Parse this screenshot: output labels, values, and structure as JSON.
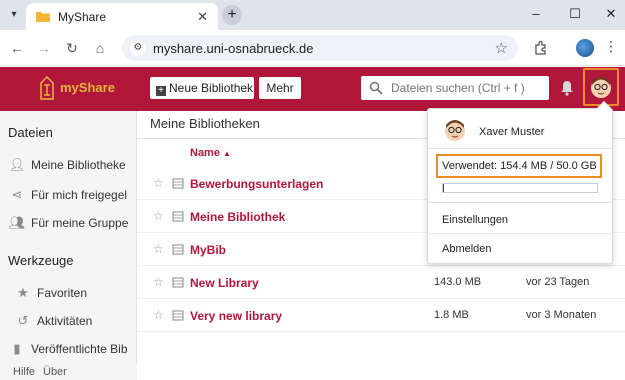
{
  "browser": {
    "tab_title": "MyShare",
    "url": "myshare.uni-osnabrueck.de"
  },
  "header": {
    "logo_text": "myShare",
    "new_library_label": "Neue Bibliothek",
    "more_label": "Mehr",
    "search_placeholder": "Dateien suchen (Ctrl + f )"
  },
  "sidebar": {
    "files_heading": "Dateien",
    "file_items": [
      {
        "label": "Meine Bibliotheke",
        "icon": "person-icon"
      },
      {
        "label": "Für mich freigegel",
        "icon": "share-icon"
      },
      {
        "label": "Für meine Gruppe",
        "icon": "group-icon"
      }
    ],
    "tools_heading": "Werkzeuge",
    "tool_items": [
      {
        "label": "Favoriten",
        "icon": "star-icon"
      },
      {
        "label": "Aktivitäten",
        "icon": "history-icon"
      },
      {
        "label": "Veröffentlichte Bib",
        "icon": "book-icon"
      }
    ],
    "footer": {
      "help": "Hilfe",
      "about": "Über"
    }
  },
  "main": {
    "title": "Meine Bibliotheken",
    "col_name": "Name",
    "sort_indicator": "▲",
    "rows": [
      {
        "name": "Bewerbungsunterlagen",
        "size": "",
        "modified": ""
      },
      {
        "name": "Meine Bibliothek",
        "size": "",
        "modified": ""
      },
      {
        "name": "MyBib",
        "size": "",
        "modified": ""
      },
      {
        "name": "New Library",
        "size": "143.0 MB",
        "modified": "vor 23 Tagen"
      },
      {
        "name": "Very new library",
        "size": "1.8 MB",
        "modified": "vor 3 Monaten"
      }
    ]
  },
  "dropdown": {
    "user_name": "Xaver Muster",
    "usage": "Verwendet: 154.4 MB / 50.0 GB",
    "usage_fraction": 0.003,
    "settings": "Einstellungen",
    "logout": "Abmelden"
  },
  "colors": {
    "brand": "#b0173b",
    "logo_gold": "#e9b23f",
    "highlight": "#f08a24"
  }
}
